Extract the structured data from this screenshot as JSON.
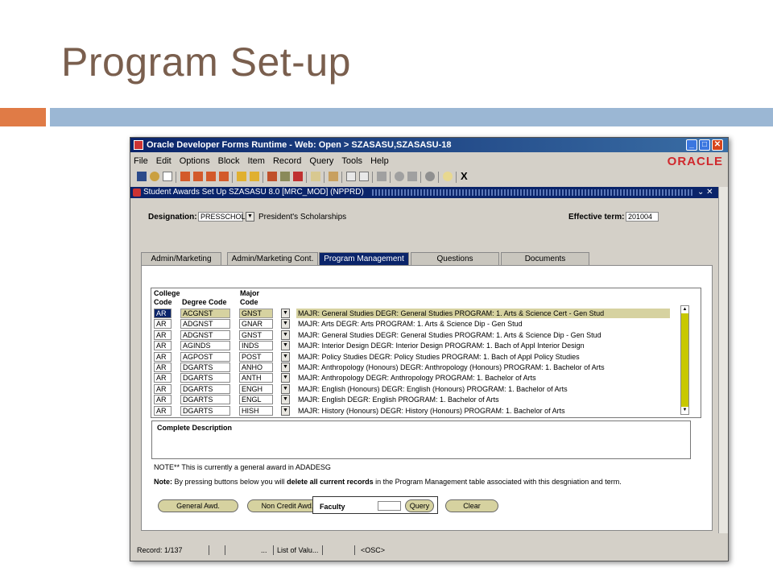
{
  "slide": {
    "title": "Program Set-up"
  },
  "window": {
    "title": "Oracle Developer Forms Runtime - Web:  Open > SZASASU,SZASASU-18",
    "controls": {
      "min": "_",
      "max": "□",
      "close": "✕"
    },
    "logo": "ORACLE"
  },
  "menu": [
    "File",
    "Edit",
    "Options",
    "Block",
    "Item",
    "Record",
    "Query",
    "Tools",
    "Help"
  ],
  "toolbar": {
    "exit_label": "X"
  },
  "form": {
    "title": "Student Awards Set Up  SZASASU  8.0  [MRC_MOD]  (NPPRD)",
    "controls": "⌄ ✕",
    "designation_label": "Designation:",
    "designation_value": "PRESSCHOL",
    "designation_desc": "President's Scholarships",
    "effective_term_label": "Effective term:",
    "effective_term_value": "201004"
  },
  "tabs": [
    "Admin/Marketing",
    "Admin/Marketing Cont.",
    "Program Management",
    "Questions",
    "Documents"
  ],
  "grid": {
    "headers": {
      "college_line1": "College",
      "college_line2": "Code",
      "degree": "Degree Code",
      "major_line1": "Major",
      "major_line2": "Code"
    },
    "rows": [
      {
        "college": "AR",
        "degree": "ACGNST",
        "major": "GNST",
        "desc": "MAJR: General Studies DEGR: General Studies PROGRAM: 1. Arts & Science Cert - Gen Stud"
      },
      {
        "college": "AR",
        "degree": "ADGNST",
        "major": "GNAR",
        "desc": "MAJR: Arts DEGR: Arts PROGRAM: 1. Arts & Science Dip - Gen Stud"
      },
      {
        "college": "AR",
        "degree": "ADGNST",
        "major": "GNST",
        "desc": "MAJR: General Studies DEGR: General Studies PROGRAM: 1. Arts & Science Dip - Gen Stud"
      },
      {
        "college": "AR",
        "degree": "AGINDS",
        "major": "INDS",
        "desc": "MAJR: Interior Design DEGR: Interior Design PROGRAM: 1. Bach of Appl Interior Design"
      },
      {
        "college": "AR",
        "degree": "AGPOST",
        "major": "POST",
        "desc": "MAJR: Policy Studies DEGR: Policy Studies PROGRAM: 1. Bach of Appl Policy Studies"
      },
      {
        "college": "AR",
        "degree": "DGARTS",
        "major": "ANHO",
        "desc": "MAJR: Anthropology (Honours) DEGR: Anthropology (Honours) PROGRAM: 1. Bachelor of Arts"
      },
      {
        "college": "AR",
        "degree": "DGARTS",
        "major": "ANTH",
        "desc": "MAJR: Anthropology DEGR: Anthropology PROGRAM: 1. Bachelor of Arts"
      },
      {
        "college": "AR",
        "degree": "DGARTS",
        "major": "ENGH",
        "desc": "MAJR: English (Honours) DEGR: English (Honours) PROGRAM: 1. Bachelor of Arts"
      },
      {
        "college": "AR",
        "degree": "DGARTS",
        "major": "ENGL",
        "desc": "MAJR: English DEGR: English PROGRAM: 1. Bachelor of Arts"
      },
      {
        "college": "AR",
        "degree": "DGARTS",
        "major": "HISH",
        "desc": "MAJR: History (Honours) DEGR: History (Honours) PROGRAM: 1. Bachelor of Arts"
      }
    ]
  },
  "complete_description_label": "Complete Description",
  "note1": "NOTE** This is currently a general award in ADADESG",
  "note2": {
    "prefix": "Note:",
    "part1": " By pressing buttons below you will ",
    "bold": "delete all current records",
    "part2": " in the Program Management table associated with this desgniation and term."
  },
  "buttons": {
    "general": "General Awd.",
    "noncredit": "Non Credit Awd.",
    "faculty_label": "Faculty",
    "query": "Query",
    "clear": "Clear"
  },
  "status": {
    "record": "Record: 1/137",
    "dots": "...",
    "lov": "List of Valu...",
    "osc": "<OSC>"
  }
}
